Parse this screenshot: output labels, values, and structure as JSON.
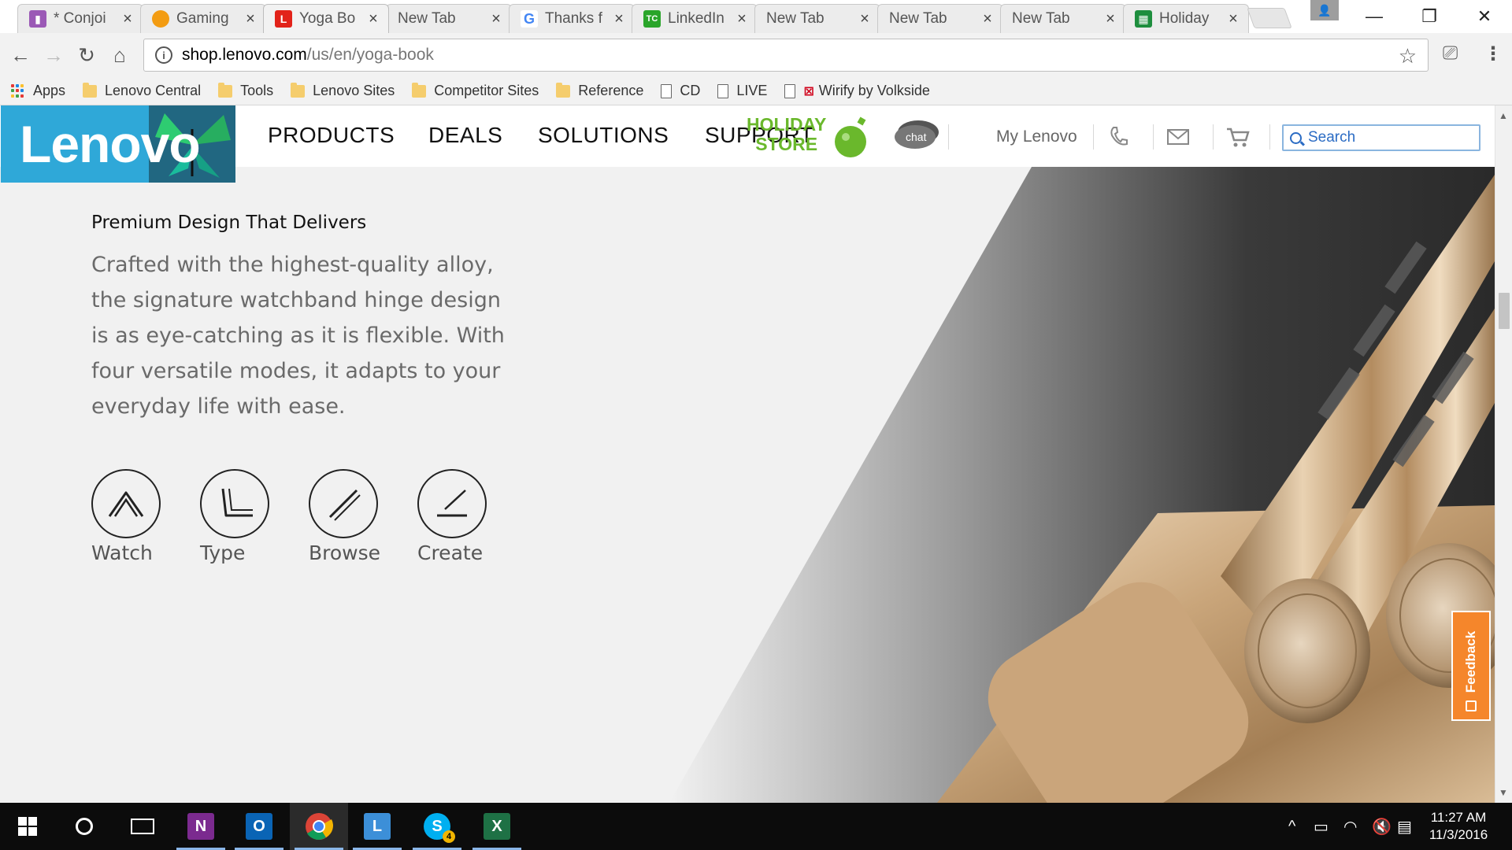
{
  "browser": {
    "tabs": [
      {
        "title": "* Conjoi",
        "favicon_color": "#9b59b6",
        "favicon_glyph": "",
        "active": false
      },
      {
        "title": "Gaming",
        "favicon_color": "#f39c12",
        "favicon_glyph": "",
        "active": false
      },
      {
        "title": "Yoga Bo",
        "favicon_color": "#e2231a",
        "favicon_glyph": "L",
        "active": true
      },
      {
        "title": "New Tab",
        "favicon_color": "",
        "favicon_glyph": "",
        "active": false
      },
      {
        "title": "Thanks f",
        "favicon_color": "#ffffff",
        "favicon_glyph": "G",
        "active": false
      },
      {
        "title": "LinkedIn",
        "favicon_color": "#2aa52a",
        "favicon_glyph": "TC",
        "active": false
      },
      {
        "title": "New Tab",
        "favicon_color": "",
        "favicon_glyph": "",
        "active": false
      },
      {
        "title": "New Tab",
        "favicon_color": "",
        "favicon_glyph": "",
        "active": false
      },
      {
        "title": "New Tab",
        "favicon_color": "",
        "favicon_glyph": "",
        "active": false
      },
      {
        "title": "Holiday",
        "favicon_color": "#1e8e3e",
        "favicon_glyph": "",
        "active": false
      }
    ],
    "url_host": "shop.lenovo.com",
    "url_path": "/us/en/yoga-book",
    "bookmarks": [
      {
        "label": "Apps",
        "icon": "apps-grid-icon"
      },
      {
        "label": "Lenovo Central",
        "icon": "folder-icon"
      },
      {
        "label": "Tools",
        "icon": "folder-icon"
      },
      {
        "label": "Lenovo Sites",
        "icon": "folder-icon"
      },
      {
        "label": "Competitor Sites",
        "icon": "folder-icon"
      },
      {
        "label": "Reference",
        "icon": "folder-icon"
      },
      {
        "label": "CD",
        "icon": "page-icon"
      },
      {
        "label": "LIVE",
        "icon": "page-icon"
      },
      {
        "label": "Wirify by Volkside",
        "icon": "page-icon"
      }
    ]
  },
  "site": {
    "logo_text": "Lenovo",
    "brand_color": "#2fa8d8",
    "nav": [
      "PRODUCTS",
      "DEALS",
      "SOLUTIONS",
      "SUPPORT"
    ],
    "holiday_line1": "HOLIDAY",
    "holiday_line2": "STORE",
    "holiday_color": "#6ab82c",
    "chat_label": "chat",
    "my_lenovo": "My Lenovo",
    "search_placeholder": "Search"
  },
  "content": {
    "title": "Premium Design That Delivers",
    "body": "Crafted with the highest-quality alloy, the signature watchband hinge design is as eye-catching as it is flexible. With four versatile modes, it adapts to your everyday life with ease.",
    "modes": [
      {
        "label": "Watch",
        "icon": "watch-mode-icon"
      },
      {
        "label": "Type",
        "icon": "type-mode-icon"
      },
      {
        "label": "Browse",
        "icon": "browse-mode-icon"
      },
      {
        "label": "Create",
        "icon": "create-mode-icon"
      }
    ]
  },
  "feedback_label": "Feedback",
  "feedback_color": "#f5862b",
  "taskbar": {
    "apps": [
      "onenote-icon",
      "outlook-icon",
      "chrome-icon",
      "lync-icon",
      "skype-icon",
      "excel-icon"
    ],
    "skype_badge": "4",
    "time": "11:27 AM",
    "date": "11/3/2016"
  }
}
